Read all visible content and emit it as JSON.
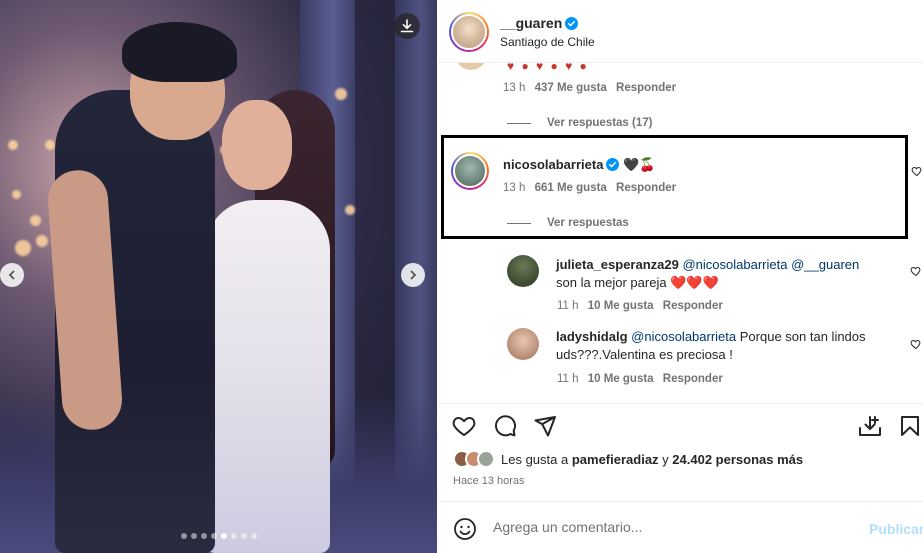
{
  "post_owner": {
    "username": "__guaren",
    "location": "Santiago de Chile"
  },
  "icons": {
    "download": "download-icon",
    "prev": "chevron-left-icon",
    "next": "chevron-right-icon",
    "verified": "verified-badge-icon",
    "more": "more-horizontal-icon",
    "like": "heart-icon",
    "comment": "comment-icon",
    "share": "send-icon",
    "save": "bookmark-icon",
    "emoji": "emoji-smile-icon"
  },
  "carousel": {
    "slide_count": 8,
    "active_index": 4
  },
  "comments": {
    "previous": {
      "emojis": "♥ ● ♥ ● ♥ ●",
      "time": "13 h",
      "likes": "437 Me gusta",
      "reply": "Responder",
      "view_replies": "Ver respuestas (17)"
    },
    "highlighted": {
      "username": "nicosolabarrieta",
      "text": "🖤🍒",
      "time": "13 h",
      "likes": "661 Me gusta",
      "reply": "Responder",
      "view_replies": "Ver respuestas"
    },
    "replies": [
      {
        "username": "julieta_esperanza29",
        "mention1": "@nicosolabarrieta",
        "mention2": "@__guaren",
        "line2": "son la mejor pareja ❤️❤️❤️",
        "time": "11 h",
        "likes": "10 Me gusta",
        "reply": "Responder"
      },
      {
        "username": "ladyshidalg",
        "mention1": "@nicosolabarrieta",
        "line1_rest": "Porque son tan lindos",
        "line2": "uds???.Valentina es preciosa !",
        "time": "11 h",
        "likes": "10 Me gusta",
        "reply": "Responder"
      }
    ]
  },
  "likes": {
    "prefix": "Les gusta a",
    "user": "pamefieradiaz",
    "middle": "y",
    "count": "24.402 personas más"
  },
  "time_ago": "Hace 13 horas",
  "add_comment": {
    "placeholder": "Agrega un comentario...",
    "publish": "Publicar"
  },
  "colors": {
    "verified": "#0095f6",
    "mention": "#00376b",
    "publish_disabled": "#b2dffc",
    "highlight_border": "#000000"
  }
}
